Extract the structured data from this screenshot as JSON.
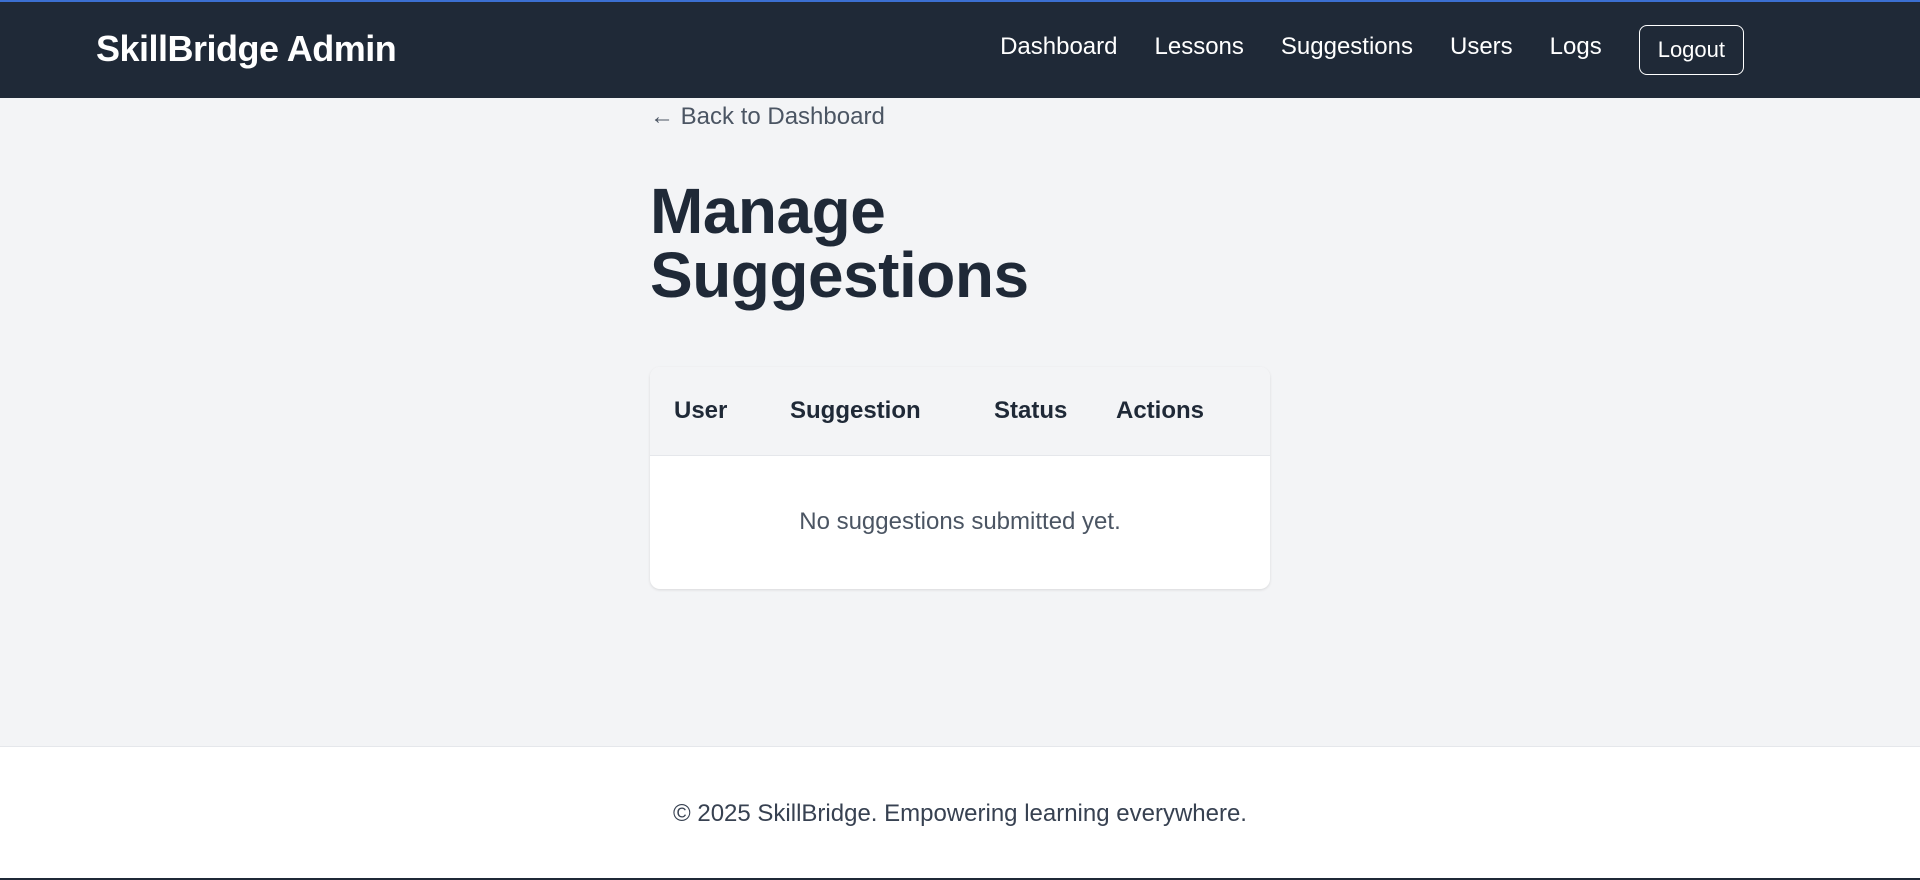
{
  "header": {
    "brand": "SkillBridge Admin",
    "nav": [
      {
        "label": "Dashboard"
      },
      {
        "label": "Lessons"
      },
      {
        "label": "Suggestions"
      },
      {
        "label": "Users"
      },
      {
        "label": "Logs"
      }
    ],
    "logout_label": "Logout"
  },
  "main": {
    "back_link": "← Back to Dashboard",
    "title": "Manage Suggestions",
    "table": {
      "columns": [
        "User",
        "Suggestion",
        "Status",
        "Actions"
      ],
      "empty_message": "No suggestions submitted yet."
    }
  },
  "footer": {
    "text": "© 2025 SkillBridge. Empowering learning everywhere."
  },
  "colors": {
    "navbar_bg": "#1f2937",
    "page_bg": "#f3f4f6",
    "card_bg": "#ffffff",
    "text_primary": "#1f2937",
    "text_muted": "#4b5563"
  }
}
